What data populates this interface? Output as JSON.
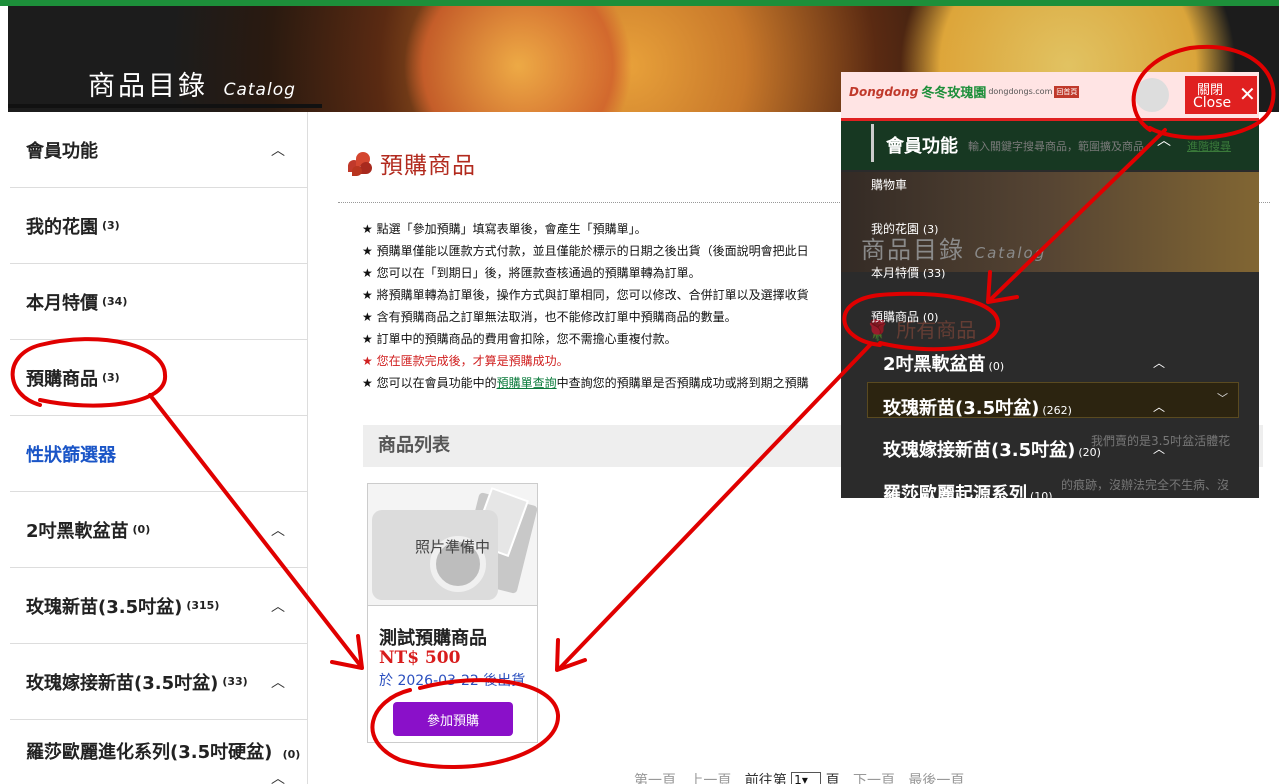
{
  "banner": {
    "title": "商品目錄",
    "subtitle": "Catalog"
  },
  "sidebar": {
    "items": [
      {
        "label": "會員功能",
        "count": ""
      },
      {
        "label": "我的花園",
        "count": "(3)"
      },
      {
        "label": "本月特價",
        "count": "(34)"
      },
      {
        "label": "預購商品",
        "count": "(3)"
      },
      {
        "label": "性狀篩選器",
        "count": ""
      },
      {
        "label": "2吋黑軟盆苗",
        "count": "(0)"
      },
      {
        "label": "玫瑰新苗(3.5吋盆)",
        "count": "(315)"
      },
      {
        "label": "玫瑰嫁接新苗(3.5吋盆)",
        "count": "(33)"
      },
      {
        "label": "羅莎歐麗進化系列(3.5吋硬盆)",
        "count": "(0)"
      }
    ]
  },
  "main": {
    "title": "預購商品",
    "notes": [
      "★ 點選「參加預購」填寫表單後，會產生「預購單」。",
      "★ 預購單僅能以匯款方式付款，並且僅能於標示的日期之後出貨（後面說明會把此日",
      "★ 您可以在「到期日」後，將匯款查核通過的預購單轉為訂單。",
      "★ 將預購單轉為訂單後，操作方式與訂單相同，您可以修改、合併訂單以及選擇收貨",
      "★ 含有預購商品之訂單無法取消，也不能修改訂單中預購商品的數量。",
      "★ 訂單中的預購商品的費用會扣除，您不需擔心重複付款。",
      "★ 您在匯款完成後，才算是預購成功。"
    ],
    "last_note_prefix": "★ 您可以在會員功能中的",
    "last_note_link": "預購單查詢",
    "last_note_suffix": "中查詢您的預購單是否預購成功或將到期之預購",
    "list_header": "商品列表"
  },
  "product": {
    "photo_text": "照片準備中",
    "name": "測試預購商品",
    "price": "NT$ 500",
    "ship": "於 2026-03-22 後出貨",
    "button": "參加預購"
  },
  "pager": {
    "first": "第一頁",
    "prev": "上一頁",
    "goto_prefix": "前往第",
    "page_value": "1",
    "goto_suffix": "頁",
    "next": "下一頁",
    "last": "最後一頁"
  },
  "overlay": {
    "logo_red": "Dongdong",
    "logo_green": "冬冬玫瑰園",
    "logo_url": "dongdongs.com",
    "logo_tag": "回首頁",
    "close_zh": "關閉",
    "close_en": "Close",
    "member_title": "會員功能",
    "search_hint": "輸入關鍵字搜尋商品，範圍擴及商品",
    "search_link": "進階搜尋",
    "menu": [
      {
        "label": "購物車",
        "count": ""
      },
      {
        "label": "我的花園",
        "count": "(3)"
      },
      {
        "label": "本月特價",
        "count": "(33)"
      },
      {
        "label": "預購商品",
        "count": "(0)"
      }
    ],
    "catalog_title": "商品目錄",
    "catalog_sub": "Catalog",
    "all_products": "所有商品",
    "categories": [
      {
        "label": "2吋黑軟盆苗",
        "count": "(0)"
      },
      {
        "label": "玫瑰新苗(3.5吋盆)",
        "count": "(262)"
      },
      {
        "label": "玫瑰嫁接新苗(3.5吋盆)",
        "count": "(20)"
      },
      {
        "label": "羅莎歐麗起源系列",
        "count": "(10)"
      }
    ],
    "faint_1": "我們賣的是3.5吋盆活體花",
    "faint_2": "的痕跡，沒辦法完全不生病、沒"
  }
}
